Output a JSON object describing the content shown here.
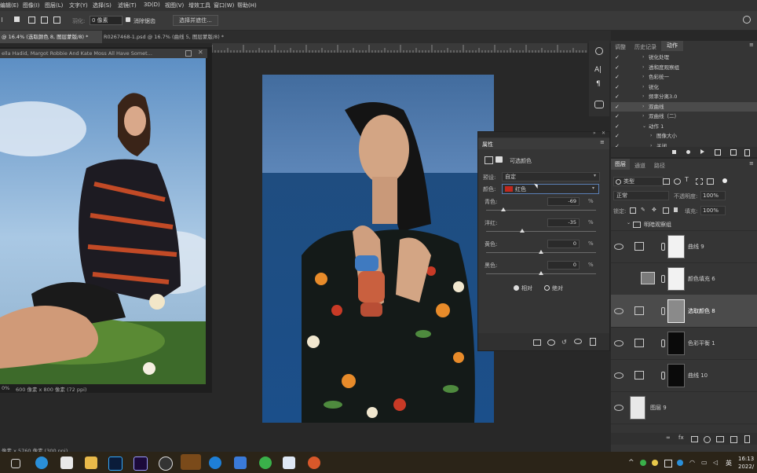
{
  "menubar": {
    "items": [
      "编辑(E)",
      "图像(I)",
      "图层(L)",
      "文字(Y)",
      "选择(S)",
      "滤镜(T)",
      "3D(D)",
      "视图(V)",
      "增效工具",
      "窗口(W)",
      "帮助(H)"
    ]
  },
  "options": {
    "feather_label": "羽化:",
    "feather_value": "0 像素",
    "antialias_label": "消除锯齿",
    "select_mask_label": "选择并遮住..."
  },
  "tabs": [
    {
      "label": "@ 16.4% (选取颜色 8, 图层蒙版/8) *"
    },
    {
      "label": "R0267468-1.psd @ 16.7% (曲线 5, 图层蒙版/8) *"
    }
  ],
  "float_doc": {
    "title": "ella Hadid, Margot Robbie And Kate Moss All Have Somet...",
    "status_zoom": "0%",
    "status_size": "600 像素 x 800 像素 (72 ppi)"
  },
  "status_main": "像素 x 5760 像素 (300 ppi)",
  "properties": {
    "title": "属性",
    "subtitle": "可选颜色",
    "preset_label": "预设:",
    "preset_value": "自定",
    "colors_label": "颜色:",
    "colors_value": "红色",
    "color_swatch": "#c0281e",
    "sliders": [
      {
        "label": "青色:",
        "value": "-69",
        "unit": "%",
        "pos": 0.155
      },
      {
        "label": "洋红:",
        "value": "-35",
        "unit": "%",
        "pos": 0.325
      },
      {
        "label": "黄色:",
        "value": "0",
        "unit": "%",
        "pos": 0.5
      },
      {
        "label": "黑色:",
        "value": "0",
        "unit": "%",
        "pos": 0.5
      }
    ],
    "method_relative": "相对",
    "method_absolute": "绝对",
    "method_selected": "relative"
  },
  "actions_panel": {
    "tabs": [
      "调整",
      "历史记录",
      "动作"
    ],
    "active_tab": "动作",
    "items": [
      "锐化处理",
      "透和度观察组",
      "色彩统一",
      "锐化",
      "频率分离3.0",
      "双曲线",
      "双曲线（二）",
      "动作 1",
      "图像大小",
      "关闭"
    ]
  },
  "layers_panel": {
    "tabs": [
      "图层",
      "通道",
      "路径"
    ],
    "active_tab": "图层",
    "filter_label": "类型",
    "blend_mode": "正常",
    "opacity_label": "不透明度:",
    "opacity_value": "100%",
    "lock_label": "锁定:",
    "fill_label": "填充:",
    "fill_value": "100%",
    "group_name": "明暗观察组",
    "layers": [
      {
        "name": "曲线 9"
      },
      {
        "name": "颜色填充 6"
      },
      {
        "name": "选取颜色 8"
      },
      {
        "name": "色彩平衡 1"
      },
      {
        "name": "曲线 10"
      },
      {
        "name": "图层 9"
      }
    ]
  },
  "taskbar": {
    "lang": "英",
    "time": "16:13",
    "date": "2022/"
  },
  "colors": {
    "accent_select": "#3d5c8c",
    "swatch_red": "#c0281e"
  }
}
